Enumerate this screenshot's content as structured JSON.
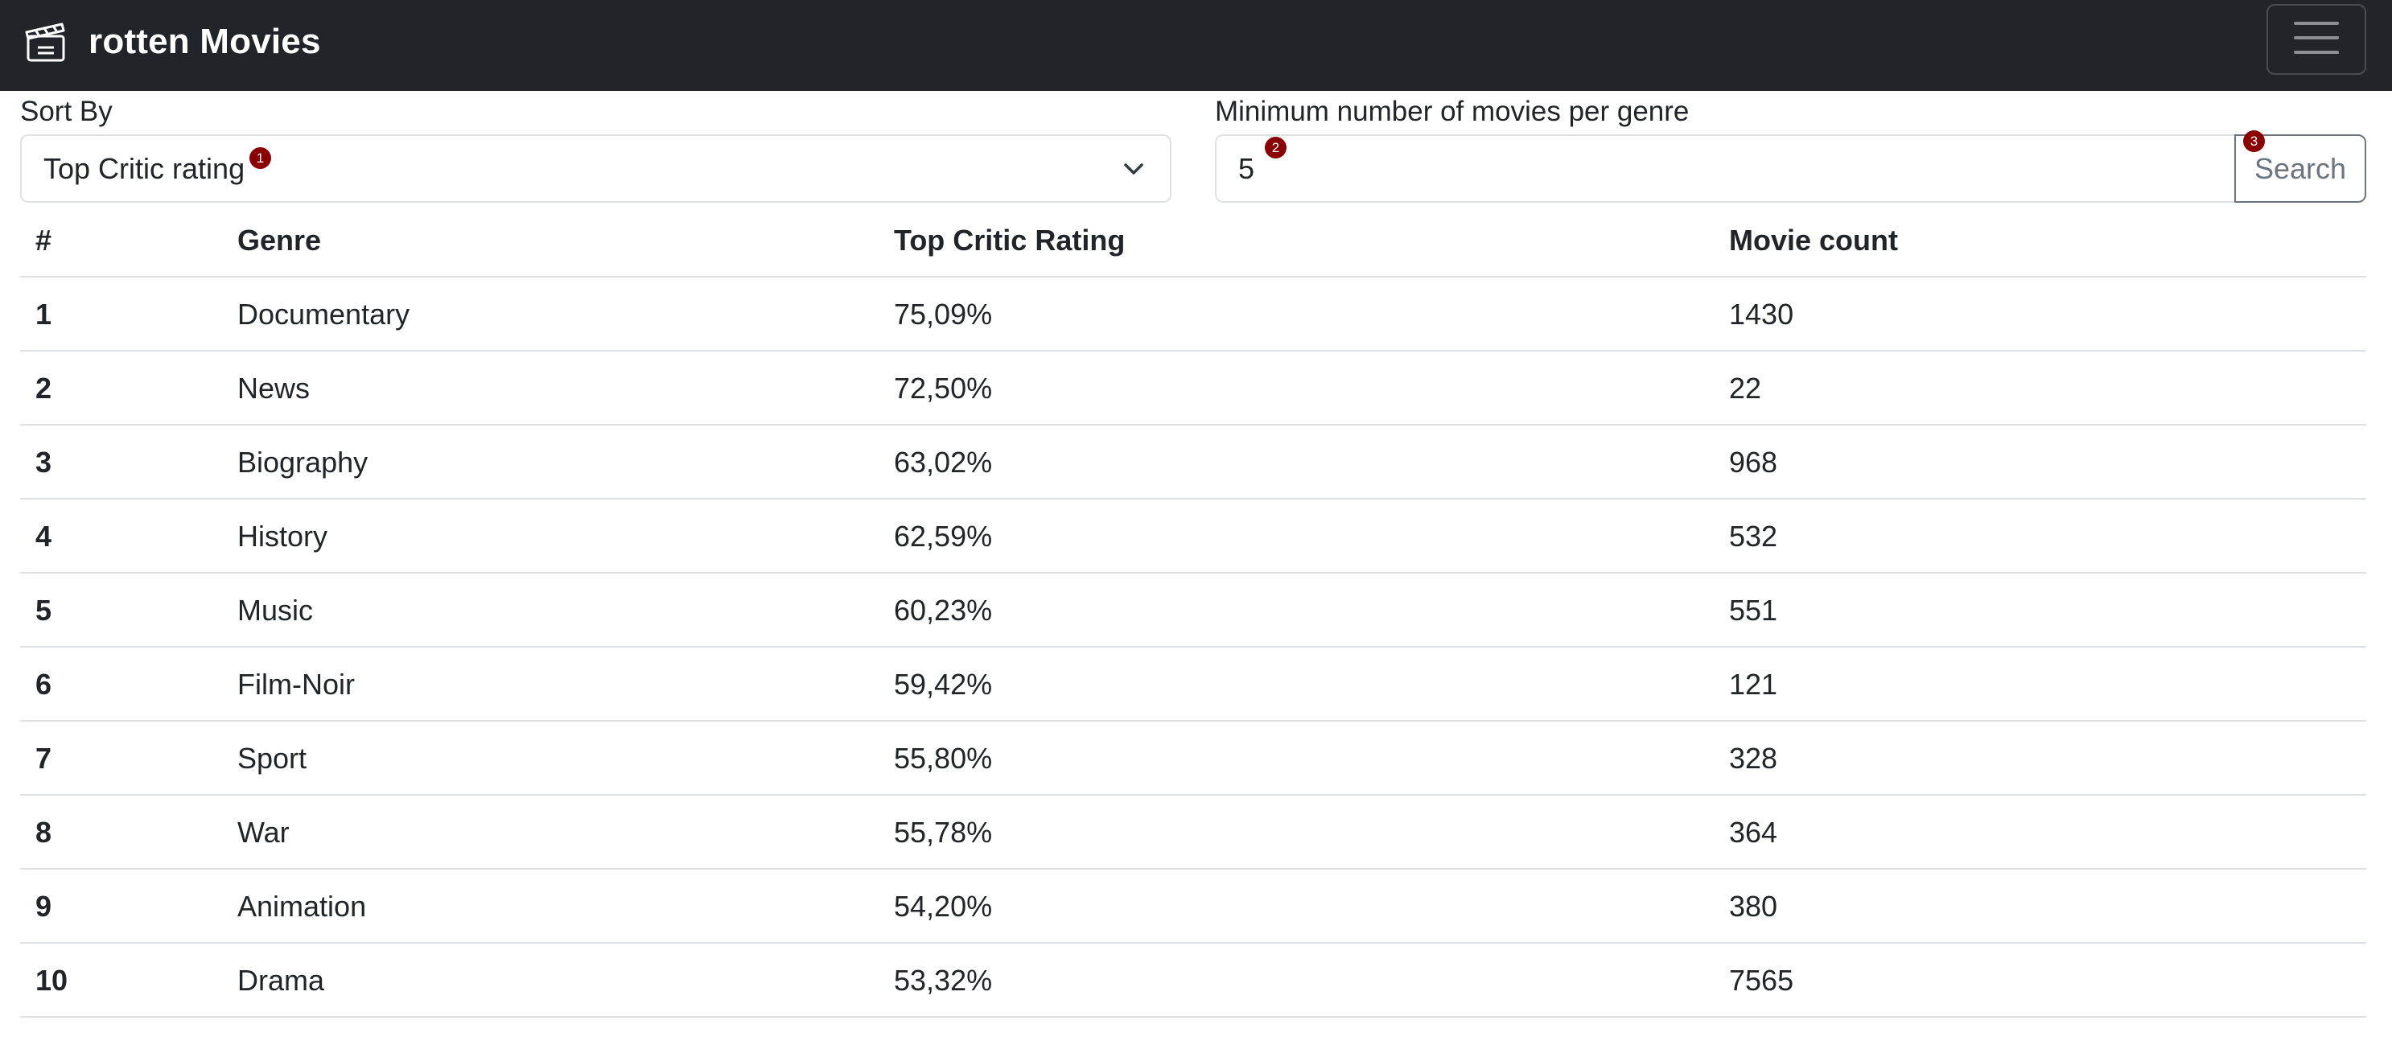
{
  "app": {
    "brand": "rotten Movies",
    "brand_icon": "clapperboard-icon",
    "menu_icon": "hamburger-menu-icon"
  },
  "filters": {
    "sort_label": "Sort By",
    "sort_value": "Top Critic rating",
    "sort_badge": "1",
    "min_label": "Minimum number of movies per genre",
    "min_value": "5",
    "min_badge": "2",
    "search_label": "Search",
    "search_badge": "3"
  },
  "colors": {
    "navbar": "#212529",
    "badge": "#8b0000",
    "border": "#dee2e6",
    "button": "#6c757d"
  },
  "table": {
    "headers": [
      "#",
      "Genre",
      "Top Critic Rating",
      "Movie count"
    ],
    "rows": [
      [
        "1",
        "Documentary",
        "75,09%",
        "1430"
      ],
      [
        "2",
        "News",
        "72,50%",
        "22"
      ],
      [
        "3",
        "Biography",
        "63,02%",
        "968"
      ],
      [
        "4",
        "History",
        "62,59%",
        "532"
      ],
      [
        "5",
        "Music",
        "60,23%",
        "551"
      ],
      [
        "6",
        "Film-Noir",
        "59,42%",
        "121"
      ],
      [
        "7",
        "Sport",
        "55,80%",
        "328"
      ],
      [
        "8",
        "War",
        "55,78%",
        "364"
      ],
      [
        "9",
        "Animation",
        "54,20%",
        "380"
      ],
      [
        "10",
        "Drama",
        "53,32%",
        "7565"
      ]
    ]
  }
}
